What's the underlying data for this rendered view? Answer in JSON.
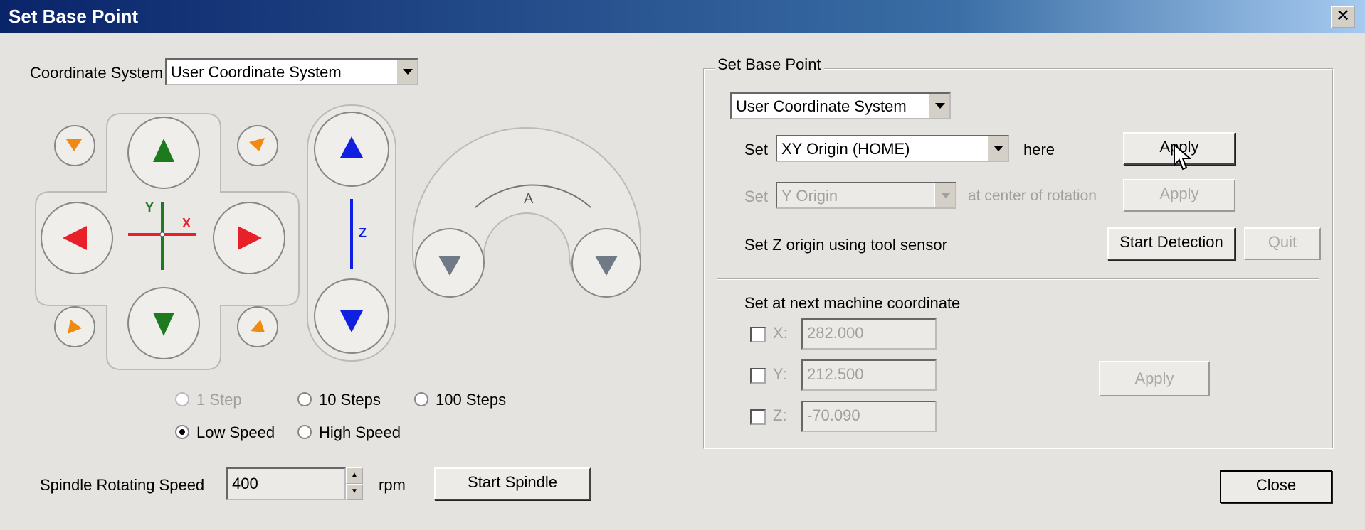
{
  "window": {
    "title": "Set Base Point",
    "close_x": "✕"
  },
  "left": {
    "coord_label": "Coordinate System",
    "coord_value": "User Coordinate System",
    "axis_labels": {
      "y": "Y",
      "x": "X",
      "z": "Z",
      "a": "A"
    },
    "steps": [
      {
        "label": "1 Step",
        "selected": false,
        "enabled": false
      },
      {
        "label": "10 Steps",
        "selected": false,
        "enabled": true
      },
      {
        "label": "100 Steps",
        "selected": false,
        "enabled": true
      }
    ],
    "speeds": [
      {
        "label": "Low Speed",
        "selected": true
      },
      {
        "label": "High Speed",
        "selected": false
      }
    ],
    "spindle_label": "Spindle Rotating Speed",
    "spindle_value": "400",
    "spindle_unit": "rpm",
    "start_spindle": "Start Spindle"
  },
  "group": {
    "title": "Set Base Point",
    "system_value": "User Coordinate System",
    "row1": {
      "set": "Set",
      "value": "XY Origin (HOME)",
      "here": "here",
      "apply": "Apply"
    },
    "row2": {
      "set": "Set",
      "value": "Y Origin",
      "suffix": "at center of rotation",
      "apply": "Apply"
    },
    "row3": {
      "label": "Set Z origin using tool sensor",
      "start": "Start Detection",
      "quit": "Quit"
    },
    "next_label": "Set at next machine coordinate",
    "coords": [
      {
        "axis": "X:",
        "value": "282.000"
      },
      {
        "axis": "Y:",
        "value": "212.500"
      },
      {
        "axis": "Z:",
        "value": "-70.090"
      }
    ],
    "apply": "Apply"
  },
  "close": "Close",
  "colors": {
    "green": "#1d7a1d",
    "red": "#e8202a",
    "blue": "#1020e0",
    "orange": "#f08a10",
    "gray": "#707a86"
  }
}
